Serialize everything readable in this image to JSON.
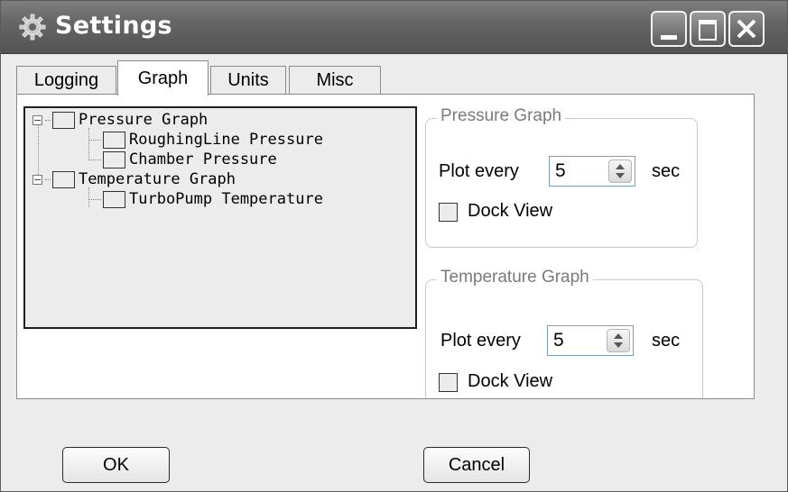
{
  "window": {
    "title": "Settings",
    "icon": "gear-icon",
    "controls": [
      "minimize-icon",
      "maximize-icon",
      "close-icon"
    ]
  },
  "tabs": [
    {
      "label": "Logging",
      "active": false
    },
    {
      "label": "Graph",
      "active": true
    },
    {
      "label": "Units",
      "active": false
    },
    {
      "label": "Misc",
      "active": false
    }
  ],
  "tree": {
    "items": [
      {
        "label": "Pressure Graph",
        "level": 0,
        "expanded": true,
        "checked": false
      },
      {
        "label": "RoughingLine Pressure",
        "level": 1,
        "checked": false
      },
      {
        "label": "Chamber Pressure",
        "level": 1,
        "checked": false
      },
      {
        "label": "Temperature Graph",
        "level": 0,
        "expanded": true,
        "checked": false
      },
      {
        "label": "TurboPump Temperature",
        "level": 1,
        "checked": false
      }
    ]
  },
  "pressure_group": {
    "title": "Pressure Graph",
    "plot_label": "Plot every",
    "plot_value": "5",
    "unit": "sec",
    "dock_label": "Dock View",
    "dock_checked": false
  },
  "temperature_group": {
    "title": "Temperature Graph",
    "plot_label": "Plot every",
    "plot_value": "5",
    "unit": "sec",
    "dock_label": "Dock View",
    "dock_checked": false
  },
  "buttons": {
    "ok": "OK",
    "cancel": "Cancel"
  }
}
